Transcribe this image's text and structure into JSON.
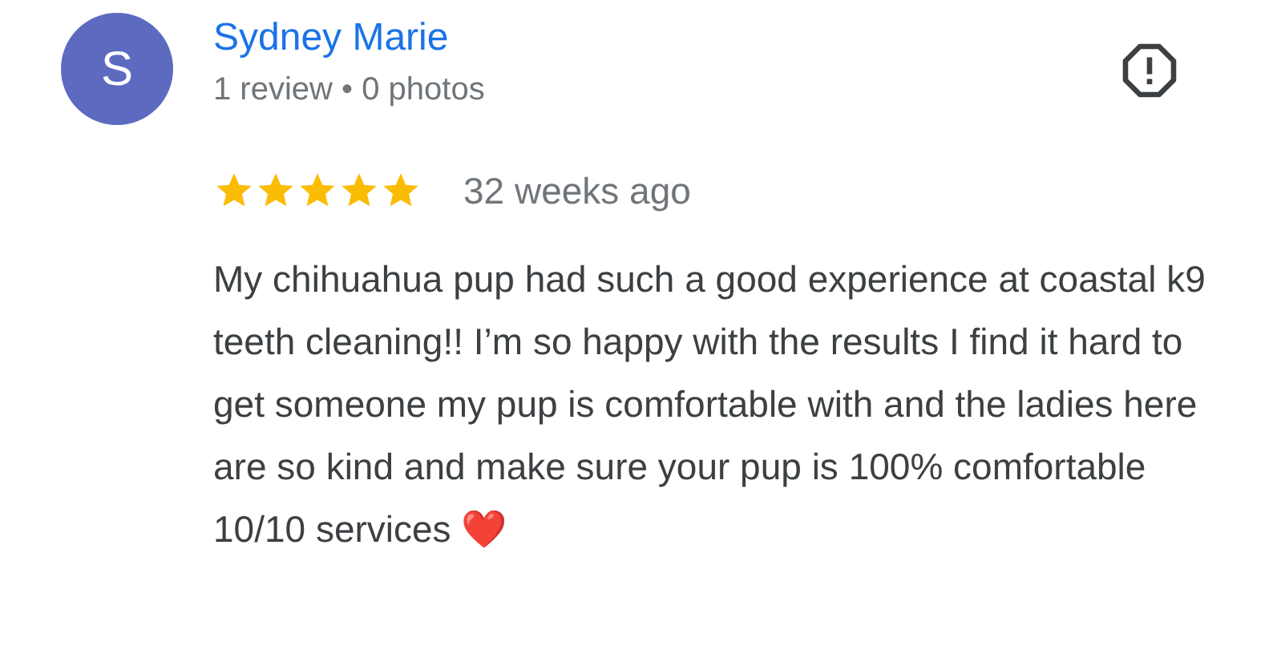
{
  "reviewer": {
    "initial": "S",
    "name": "Sydney Marie",
    "meta": "1 review • 0 photos"
  },
  "review": {
    "stars": 5,
    "time": "32 weeks ago",
    "text": "My chihuahua pup had such a good experience at coastal k9 teeth cleaning!! I’m so happy with the results I find it hard to get someone my pup is comfortable with and the ladies here are so kind and make sure your pup is 100% comfortable 10/10 services ❤️"
  }
}
